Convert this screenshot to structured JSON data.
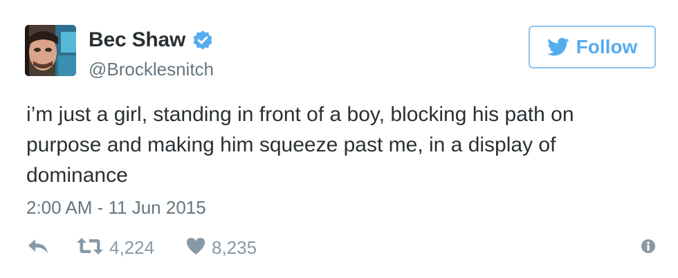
{
  "author": {
    "display_name": "Bec Shaw",
    "handle": "@Brocklesnitch",
    "verified": true,
    "avatar_icon": "profile-photo"
  },
  "follow_button": {
    "label": "Follow",
    "icon": "twitter-bird-icon"
  },
  "tweet": {
    "text": "i’m just a girl, standing in front of a boy, blocking his path on purpose and making him squeeze past me, in a display of dominance",
    "timestamp": "2:00 AM - 11 Jun 2015"
  },
  "actions": {
    "reply_icon": "reply-icon",
    "retweet_icon": "retweet-icon",
    "retweet_count": "4,224",
    "like_icon": "heart-icon",
    "like_count": "8,235",
    "info_icon": "info-icon"
  },
  "colors": {
    "brand_blue": "#55acee",
    "follow_border": "#8dc3ee",
    "text": "#292f33",
    "secondary_text": "#66757f",
    "action_gray": "#8899a6"
  }
}
